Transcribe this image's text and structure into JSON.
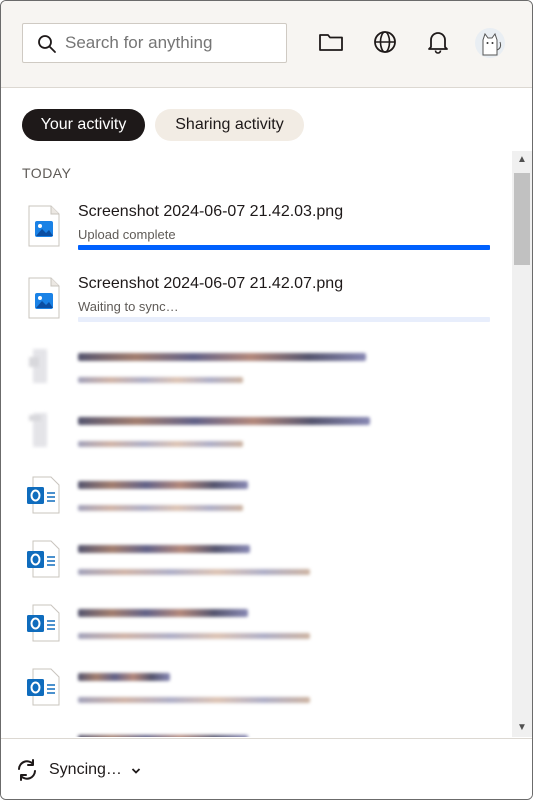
{
  "header": {
    "search_placeholder": "Search for anything",
    "icons": [
      "search-icon",
      "folder-icon",
      "globe-icon",
      "bell-icon",
      "avatar"
    ]
  },
  "tabs": [
    {
      "label": "Your activity",
      "active": true
    },
    {
      "label": "Sharing activity",
      "active": false
    }
  ],
  "section": {
    "label": "TODAY"
  },
  "items": [
    {
      "name": "Screenshot 2024-06-07 21.42.03.png",
      "status": "Upload complete",
      "icon": "image-file-icon",
      "progress": 1.0
    },
    {
      "name": "Screenshot 2024-06-07 21.42.07.png",
      "status": "Waiting to sync…",
      "icon": "image-file-icon",
      "progress": 0.0
    },
    {
      "name": "",
      "status": "",
      "icon": "file-icon",
      "redacted": true
    },
    {
      "name": "",
      "status": "",
      "icon": "file-icon",
      "redacted": true
    },
    {
      "name": "",
      "status": "",
      "icon": "outlook-file-icon",
      "redacted": true
    },
    {
      "name": "",
      "status": "",
      "icon": "outlook-file-icon",
      "redacted": true
    },
    {
      "name": "",
      "status": "",
      "icon": "outlook-file-icon",
      "redacted": true
    },
    {
      "name": "",
      "status": "",
      "icon": "outlook-file-icon",
      "redacted": true
    },
    {
      "name": "",
      "status": "",
      "icon": "outlook-file-icon",
      "redacted": true
    }
  ],
  "footer": {
    "sync_label": "Syncing…",
    "icons": [
      "sync-icon",
      "chevron-down-icon"
    ]
  },
  "colors": {
    "accent": "#0061fe",
    "active_tab": "#1e1919",
    "inactive_tab": "#f2ece4",
    "header_bg": "#f7f5f2"
  }
}
